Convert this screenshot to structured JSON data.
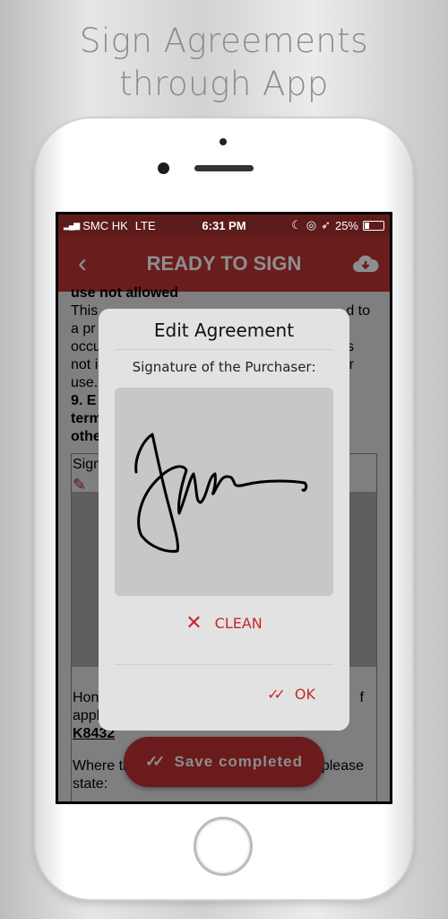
{
  "headline": {
    "line1": "Sign Agreements",
    "line2": "through App"
  },
  "status_bar": {
    "carrier": "SMC HK",
    "network": "LTE",
    "time": "6:31 PM",
    "battery": "25%",
    "battery_level": 0.25
  },
  "nav": {
    "title": "READY TO SIGN",
    "back_icon": "chevron-left-icon",
    "download_icon": "cloud-download-icon"
  },
  "document": {
    "line0": "use not allowed",
    "line1_left": "This",
    "line1_right": "d to",
    "line2_left": "a pr",
    "line3_left": "occu",
    "line3_right": "s",
    "line4_left": "not i",
    "line4_right": "r",
    "line5_left": "use.",
    "line6_left": "9. E",
    "line7_left": "term",
    "line8_left": "othe",
    "sign_label": "Sign",
    "hon_left": "Hon",
    "hon_right": "f",
    "applicable": "applicable)",
    "code": "K8432",
    "where_left": "Where th",
    "where_right": "please",
    "state": "state:"
  },
  "modal": {
    "title": "Edit Agreement",
    "label": "Signature of the Purchaser:",
    "clean_label": "CLEAN",
    "ok_label": "OK"
  },
  "toast": {
    "label": "Save completed"
  },
  "colors": {
    "accent": "#c62828",
    "nav": "#6a1d1d",
    "status": "#5e1b1b"
  }
}
